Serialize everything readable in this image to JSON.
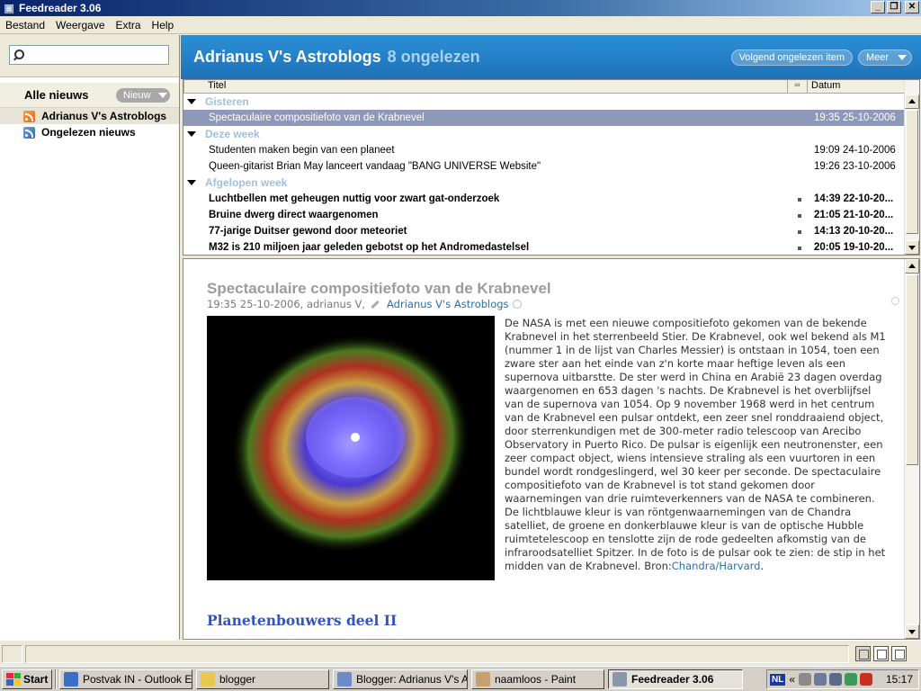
{
  "window": {
    "title": "Feedreader 3.06"
  },
  "menu": [
    "Bestand",
    "Weergave",
    "Extra",
    "Help"
  ],
  "sidebar": {
    "search_placeholder": "",
    "all_news_label": "Alle nieuws",
    "new_button_label": "Nieuw",
    "feeds": [
      {
        "label": "Adrianus V's Astroblogs",
        "icon": "rss-orange-icon",
        "selected": true
      },
      {
        "label": "Ongelezen nieuws",
        "icon": "rss-blue-icon",
        "selected": false
      }
    ]
  },
  "header": {
    "feed_title": "Adrianus V's Astroblogs",
    "unread": "8 ongelezen",
    "next_unread_label": "Volgend ongelezen item",
    "more_label": "Meer"
  },
  "list": {
    "col_title": "Titel",
    "col_flag": "∞",
    "col_date": "Datum",
    "groups": [
      {
        "label": "Gisteren",
        "items": [
          {
            "title": "Spectaculaire compositiefoto van de Krabnevel",
            "date": "19:35 25-10-2006",
            "selected": true,
            "unread": false
          }
        ]
      },
      {
        "label": "Deze week",
        "items": [
          {
            "title": "Studenten maken begin van een planeet",
            "date": "19:09 24-10-2006",
            "selected": false,
            "unread": false
          },
          {
            "title": "Queen-gitarist Brian May lanceert vandaag \"BANG UNIVERSE Website\"",
            "date": "19:26 23-10-2006",
            "selected": false,
            "unread": false
          }
        ]
      },
      {
        "label": "Afgelopen week",
        "items": [
          {
            "title": "Luchtbellen met geheugen nuttig voor zwart gat-onderzoek",
            "date": "14:39 22-10-20...",
            "selected": false,
            "unread": true
          },
          {
            "title": "Bruine dwerg direct waargenomen",
            "date": "21:05 21-10-20...",
            "selected": false,
            "unread": true
          },
          {
            "title": "77-jarige Duitser gewond door meteoriet",
            "date": "14:13 20-10-20...",
            "selected": false,
            "unread": true
          },
          {
            "title": "M32 is 210 miljoen jaar geleden gebotst op het Andromedastelsel",
            "date": "20:05 19-10-20...",
            "selected": false,
            "unread": true
          }
        ]
      }
    ]
  },
  "article": {
    "title": "Spectaculaire compositiefoto van de Krabnevel",
    "meta": "19:35 25-10-2006, adrianus V,",
    "source": "Adrianus V's Astroblogs",
    "body": "De NASA is met een nieuwe compositiefoto gekomen van de bekende Krabnevel in het sterrenbeeld Stier. De Krabnevel, ook wel bekend als M1 (nummer 1 in de lijst van Charles Messier) is ontstaan in 1054, toen een zware ster aan het einde van z'n korte maar heftige leven als een supernova uitbarstte. De ster werd in China en Arabië 23 dagen overdag waargenomen en 653 dagen 's nachts. De Krabnevel is het overblijfsel van de supernova van 1054. Op 9 november 1968 werd in het centrum van de Krabnevel een pulsar ontdekt, een zeer snel ronddraaiend object, door sterrenkundigen met de 300-meter radio telescoop van Arecibo Observatory in Puerto Rico. De pulsar is eigenlijk een neutronenster, een zeer compact object, wiens intensieve straling als een vuurtoren in een bundel wordt rondgeslingerd, wel 30 keer per seconde. De spectaculaire compositiefoto van de Krabnevel is tot stand gekomen door waarnemingen van drie ruimteverkenners van de NASA te combineren. De lichtblauwe kleur is van röntgenwaarnemingen van de Chandra satelliet, de groene en donkerblauwe kleur is van de optische Hubble ruimtetelescoop en tenslotte zijn de rode gedeelten afkomstig van de infraroodsatelliet Spitzer. In de foto is de pulsar ook te zien: de stip in het midden van de Krabnevel. Bron:",
    "source_link": "Chandra/Harvard",
    "body_end": ".",
    "next_title": "Planetenbouwers deel II"
  },
  "taskbar": {
    "start": "Start",
    "tasks": [
      {
        "label": "Postvak IN - Outlook E...",
        "icon": "outlook-icon",
        "active": false
      },
      {
        "label": "blogger",
        "icon": "folder-icon",
        "active": false
      },
      {
        "label": "Blogger: Adrianus V's A...",
        "icon": "browser-icon",
        "active": false
      },
      {
        "label": "naamloos - Paint",
        "icon": "paint-icon",
        "active": false
      },
      {
        "label": "Feedreader 3.06",
        "icon": "feedreader-icon",
        "active": true
      }
    ],
    "lang": "NL",
    "chevron": "«",
    "clock": "15:17"
  }
}
